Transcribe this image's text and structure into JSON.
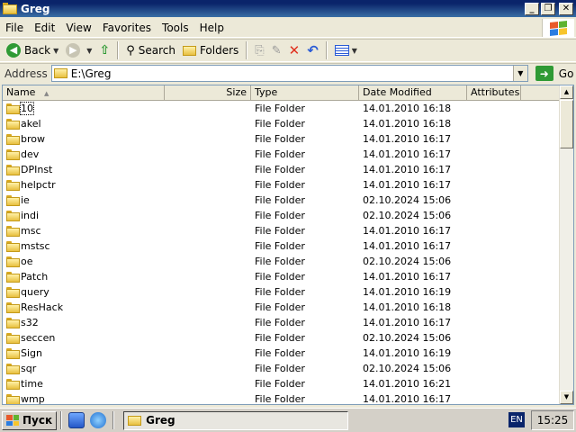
{
  "window": {
    "title": "Greg"
  },
  "menu": {
    "items": [
      "File",
      "Edit",
      "View",
      "Favorites",
      "Tools",
      "Help"
    ]
  },
  "toolbar": {
    "back_label": "Back",
    "search_label": "Search",
    "folders_label": "Folders"
  },
  "address": {
    "label": "Address",
    "value": "E:\\Greg",
    "go_label": "Go"
  },
  "columns": {
    "name": "Name",
    "size": "Size",
    "type": "Type",
    "date": "Date Modified",
    "attributes": "Attributes"
  },
  "files": [
    {
      "name": "10",
      "type": "File Folder",
      "date": "14.01.2010 16:18"
    },
    {
      "name": "akel",
      "type": "File Folder",
      "date": "14.01.2010 16:18"
    },
    {
      "name": "brow",
      "type": "File Folder",
      "date": "14.01.2010 16:17"
    },
    {
      "name": "dev",
      "type": "File Folder",
      "date": "14.01.2010 16:17"
    },
    {
      "name": "DPInst",
      "type": "File Folder",
      "date": "14.01.2010 16:17"
    },
    {
      "name": "helpctr",
      "type": "File Folder",
      "date": "14.01.2010 16:17"
    },
    {
      "name": "ie",
      "type": "File Folder",
      "date": "02.10.2024 15:06"
    },
    {
      "name": "indi",
      "type": "File Folder",
      "date": "02.10.2024 15:06"
    },
    {
      "name": "msc",
      "type": "File Folder",
      "date": "14.01.2010 16:17"
    },
    {
      "name": "mstsc",
      "type": "File Folder",
      "date": "14.01.2010 16:17"
    },
    {
      "name": "oe",
      "type": "File Folder",
      "date": "02.10.2024 15:06"
    },
    {
      "name": "Patch",
      "type": "File Folder",
      "date": "14.01.2010 16:17"
    },
    {
      "name": "query",
      "type": "File Folder",
      "date": "14.01.2010 16:19"
    },
    {
      "name": "ResHack",
      "type": "File Folder",
      "date": "14.01.2010 16:18"
    },
    {
      "name": "s32",
      "type": "File Folder",
      "date": "14.01.2010 16:17"
    },
    {
      "name": "seccen",
      "type": "File Folder",
      "date": "02.10.2024 15:06"
    },
    {
      "name": "Sign",
      "type": "File Folder",
      "date": "14.01.2010 16:19"
    },
    {
      "name": "sqr",
      "type": "File Folder",
      "date": "02.10.2024 15:06"
    },
    {
      "name": "time",
      "type": "File Folder",
      "date": "14.01.2010 16:21"
    },
    {
      "name": "wmp",
      "type": "File Folder",
      "date": "14.01.2010 16:17"
    }
  ],
  "taskbar": {
    "start_label": "Пуск",
    "task_label": "Greg",
    "lang": "EN",
    "clock": "15:25"
  }
}
